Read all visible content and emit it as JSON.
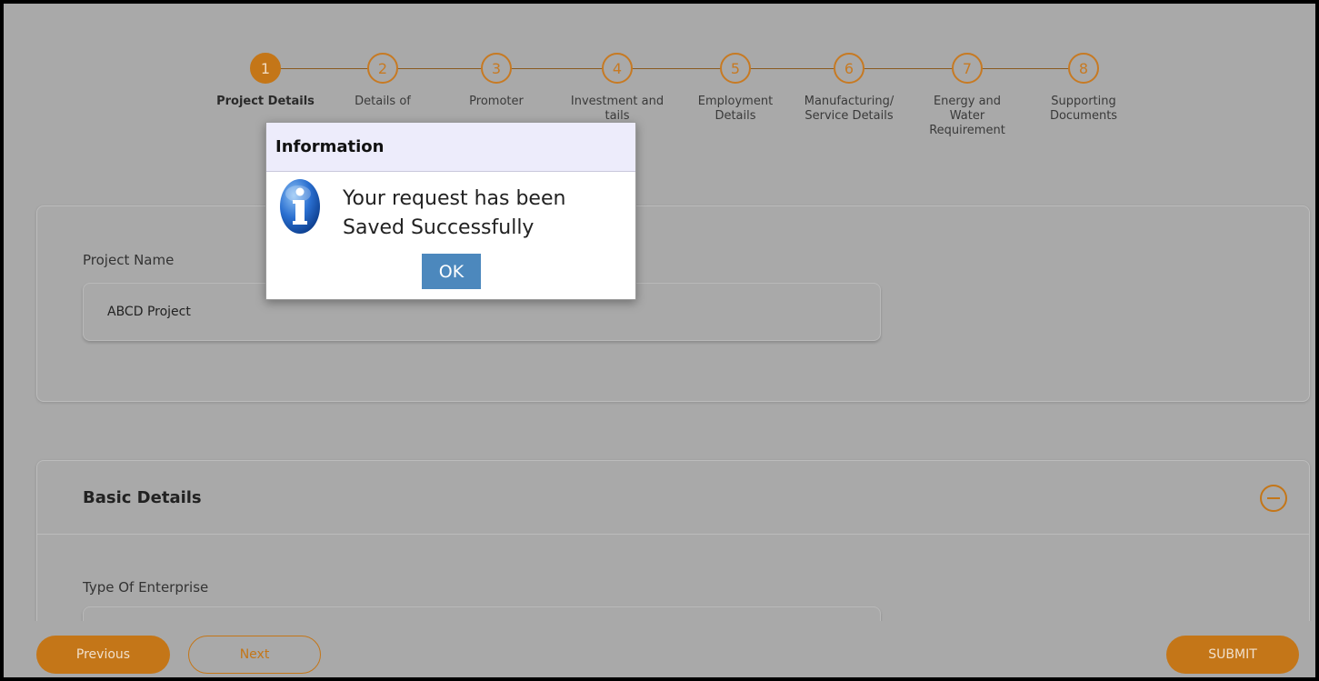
{
  "stepper": {
    "steps": [
      {
        "number": "1",
        "label": "Project Details",
        "active": true
      },
      {
        "number": "2",
        "label": "Details of"
      },
      {
        "number": "3",
        "label": "Promoter"
      },
      {
        "number": "4",
        "label": "Investment and\ntails"
      },
      {
        "number": "5",
        "label": "Employment\nDetails"
      },
      {
        "number": "6",
        "label": "Manufacturing/\nService Details"
      },
      {
        "number": "7",
        "label": "Energy and\nWater\nRequirement"
      },
      {
        "number": "8",
        "label": "Supporting\nDocuments"
      }
    ]
  },
  "project": {
    "label": "Project Name",
    "value": "ABCD Project"
  },
  "basic_details": {
    "title": "Basic Details",
    "type_label": "Type Of Enterprise"
  },
  "footer": {
    "previous": "Previous",
    "next": "Next",
    "submit": "SUBMIT"
  },
  "dialog": {
    "title": "Information",
    "message_line1": "Your request has been",
    "message_line2": "Saved Successfully",
    "ok": "OK"
  },
  "colors": {
    "accent": "#c47618",
    "overlay_bg": "#a9a9a9",
    "ok_button": "#4c88bd"
  }
}
